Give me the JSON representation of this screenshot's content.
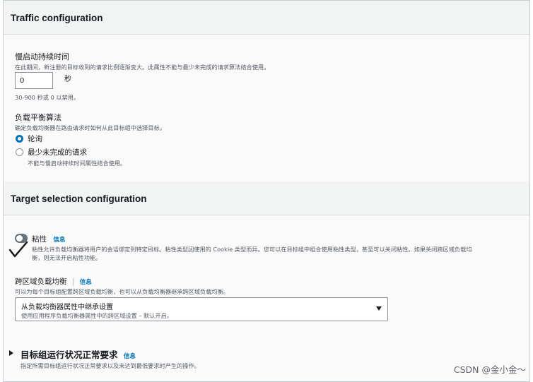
{
  "traffic": {
    "title": "Traffic configuration",
    "slow_start": {
      "label": "慢启动持续时间",
      "description": "在此期间，新注册的目标收到的请求比例逐渐变大。此属性不能与最少未完成的请求算法结合使用。",
      "value": "0",
      "unit": "秒",
      "hint": "30-900 秒或 0 以禁用。"
    },
    "algorithm": {
      "label": "负载平衡算法",
      "description": "确定负载均衡器在路由请求时如何从此目标组中选择目标。",
      "options": [
        {
          "label": "轮询",
          "selected": true
        },
        {
          "label": "最少未完成的请求",
          "selected": false,
          "note": "不能与慢启动持续时间属性结合使用。"
        }
      ]
    }
  },
  "target_selection": {
    "title": "Target selection configuration",
    "stickiness": {
      "label": "粘性",
      "info": "信息",
      "description_line1": "粘性允许负载均衡器将用户的会话绑定到特定目标。粘性类型因使用的 Cookie 类型而异。您可以在目标组中组合使用粘性类型，甚至可以关闭粘性。如果关闭跨区域负载均",
      "description_line2": "衡，则无法开启粘性功能。",
      "enabled": false
    },
    "cross_zone": {
      "label": "跨区域负载均衡",
      "info": "信息",
      "description": "可以为每个目标组配置跨区域负载均衡，也可以从负载均衡器继承跨区域负载均衡。",
      "selected_value": "从负载均衡器属性中继承设置",
      "selected_sub": "使用应用程序负载均衡器属性中的跨区域设置 – 默认开启。"
    }
  },
  "health": {
    "title": "目标组运行状况正常要求",
    "info": "信息",
    "description": "指定所需目标组运行状况正常要求以及未达到最低要求时产生的操作。"
  },
  "watermark": "CSDN @金小金～"
}
